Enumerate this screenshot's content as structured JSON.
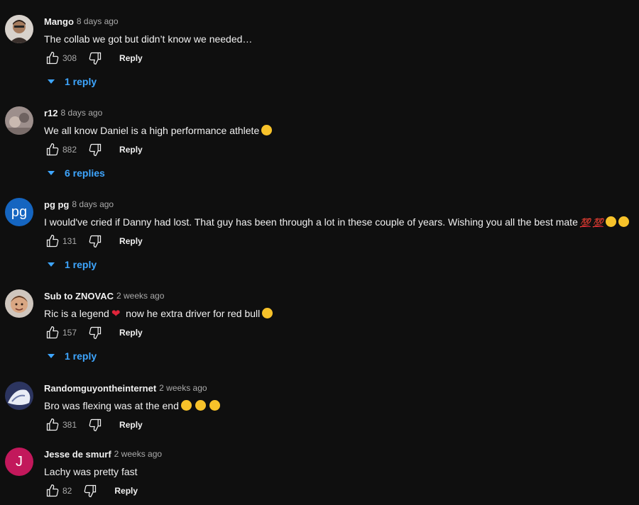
{
  "comments": [
    {
      "author": "Mango",
      "time": "8 days ago",
      "text": "The collab we got but didn’t know we needed…",
      "likes": "308",
      "reply_label": "Reply",
      "replies_label": "1 reply",
      "avatar": {
        "type": "photo",
        "color": "#8a7060"
      }
    },
    {
      "author": "r12",
      "time": "8 days ago",
      "text": "We all know Daniel is a high performance athlete",
      "likes": "882",
      "reply_label": "Reply",
      "replies_label": "6 replies",
      "avatar": {
        "type": "photo",
        "color": "#9a8a88"
      }
    },
    {
      "author": "pg pg",
      "time": "8 days ago",
      "text": "I would've cried if Danny had lost. That guy has been through a lot in these couple of years. Wishing you all the best mate",
      "likes": "131",
      "reply_label": "Reply",
      "replies_label": "1 reply",
      "avatar": {
        "type": "initials",
        "initials": "pg",
        "color": "#1565c0"
      }
    },
    {
      "author": "Sub to ZNOVAC",
      "time": "2 weeks ago",
      "text_a": "Ric is a legend",
      "text_b": "  now he extra driver for red bull",
      "likes": "157",
      "reply_label": "Reply",
      "replies_label": "1 reply",
      "avatar": {
        "type": "photo",
        "color": "#c79a7a"
      }
    },
    {
      "author": "Randomguyontheinternet",
      "time": "2 weeks ago",
      "text": "Bro was flexing was at the end",
      "likes": "381",
      "reply_label": "Reply",
      "avatar": {
        "type": "photo",
        "color": "#4a5a8a"
      }
    },
    {
      "author": "Jesse de smurf",
      "time": "2 weeks ago",
      "text": "Lachy was pretty fast",
      "likes": "82",
      "reply_label": "Reply",
      "avatar": {
        "type": "initials",
        "initials": "J",
        "color": "#c2185b"
      }
    }
  ],
  "emoji": {
    "hundred": "💯",
    "heart": "❤"
  },
  "colors": {
    "background": "#0f0f0f",
    "link": "#3ea6ff",
    "muted": "#aaaaaa"
  },
  "icons": {
    "like": "thumbs-up-icon",
    "dislike": "thumbs-down-icon",
    "expand": "caret-down-icon"
  }
}
